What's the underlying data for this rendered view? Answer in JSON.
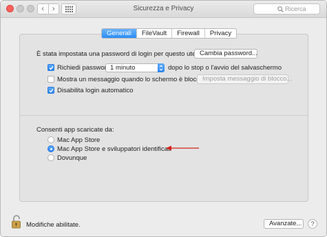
{
  "window": {
    "title": "Sicurezza e Privacy"
  },
  "toolbar": {
    "back_icon": "chevron-left-icon",
    "forward_icon": "chevron-right-icon",
    "grid_icon": "grid-icon"
  },
  "search": {
    "placeholder": "Ricerca"
  },
  "tabs": [
    {
      "label": "Generali",
      "active": true
    },
    {
      "label": "FileVault",
      "active": false
    },
    {
      "label": "Firewall",
      "active": false
    },
    {
      "label": "Privacy",
      "active": false
    }
  ],
  "password": {
    "text": "È stata impostata una password di login per questo utente",
    "change_button": "Cambia password..."
  },
  "require_password": {
    "label": "Richiedi password",
    "checked": true,
    "selected_option": "1 minuto",
    "suffix": "dopo lo stop o l'avvio del salvaschermo"
  },
  "show_message": {
    "label": "Mostra un messaggio quando lo schermo è bloccato",
    "checked": false,
    "button": "Imposta messaggio di blocco..."
  },
  "disable_autologin": {
    "label": "Disabilita login automatico",
    "checked": true
  },
  "allow_apps": {
    "heading": "Consenti app scaricate da:",
    "options": [
      {
        "label": "Mac App Store",
        "selected": false
      },
      {
        "label": "Mac App Store e sviluppatori identificati",
        "selected": true
      },
      {
        "label": "Dovunque",
        "selected": false
      }
    ]
  },
  "footer": {
    "lock_status": "Modifiche abilitate.",
    "advanced_button": "Avanzate...",
    "help_button": "?"
  },
  "colors": {
    "accent": "#2a8cf4",
    "annotation_arrow": "#d4221c"
  }
}
